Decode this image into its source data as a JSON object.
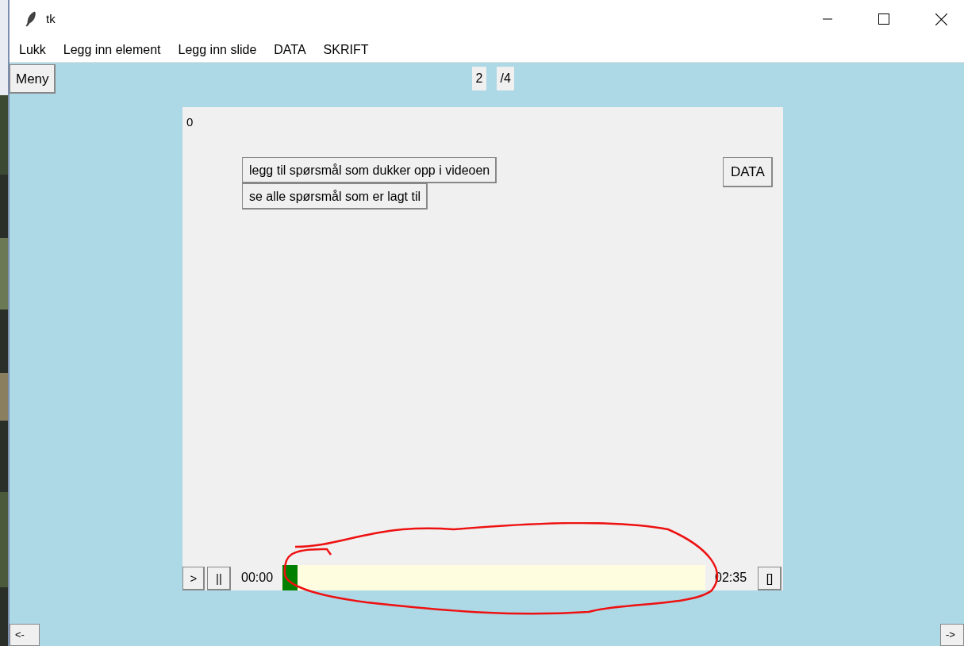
{
  "window": {
    "title": "tk"
  },
  "menu": [
    "Lukk",
    "Legg inn element",
    "Legg inn slide",
    "DATA",
    "SKRIFT"
  ],
  "menu_button": "Meny",
  "slide_counter": {
    "current": "2",
    "total": "/4"
  },
  "slide": {
    "index_label": "0",
    "buttons": [
      "legg til spørsmål som dukker opp i videoen",
      "se alle spørsmål som er lagt til"
    ],
    "data_button": "DATA"
  },
  "player": {
    "play": ">",
    "pause": "||",
    "elapsed": "00:00",
    "level": 0.036,
    "duration": "02:35",
    "fullscreen": "[]"
  },
  "nav": {
    "prev": "<-",
    "next": "->"
  }
}
